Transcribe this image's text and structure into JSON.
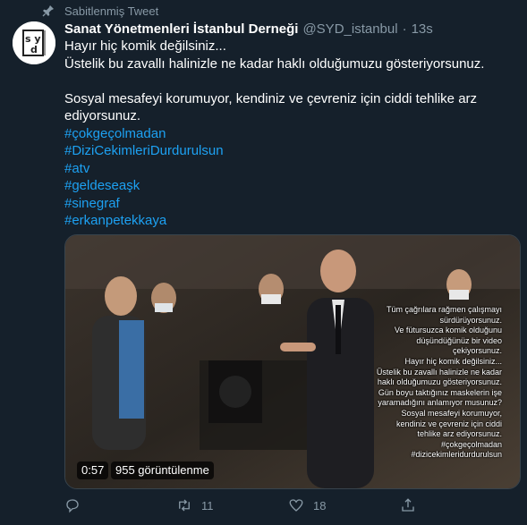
{
  "tweet": {
    "pinned_label": "Sabitlenmiş Tweet",
    "author_name": "Sanat Yönetmenleri İstanbul Derneği",
    "author_handle": "@SYD_istanbul",
    "separator": "·",
    "timestamp": "13s",
    "avatar_text": "SYD",
    "lines": [
      "Hayır hiç komik değilsiniz...",
      "Üstelik bu zavallı halinizle ne kadar haklı olduğumuzu gösteriyorsunuz.",
      "Sosyal mesafeyi korumuyor, kendiniz ve çevreniz için ciddi tehlike arz ediyorsunuz."
    ],
    "hashtags": [
      "#çokgeçolmadan",
      "#DiziCekimleriDurdurulsun",
      "#atv",
      "#geldeseaşk",
      "#sinegraf",
      "#erkanpetekkaya"
    ]
  },
  "media": {
    "duration": "0:57",
    "views": "955 görüntülenme",
    "overlay_lines": [
      "Tüm çağrılara rağmen çalışmayı",
      "sürdürüyorsunuz.",
      "Ve fütursuzca komik olduğunu",
      "düşündüğünüz bir video",
      "çekiyorsunuz.",
      "Hayır hiç komik değilsiniz...",
      "Üstelik bu zavallı halinizle ne kadar",
      "haklı olduğumuzu gösteriyorsunuz.",
      "Gün boyu taktığınız maskelerin işe",
      "yaramadığını anlamıyor musunuz?",
      "Sosyal mesafeyi korumuyor,",
      "kendiniz ve çevreniz için ciddi",
      "tehlike arz ediyorsunuz.",
      "#çokgeçolmadan",
      "#dizicekimleridurdurulsun"
    ]
  },
  "actions": {
    "reply_count": "",
    "retweet_count": "11",
    "like_count": "18",
    "share_count": ""
  },
  "colors": {
    "background": "#15202b",
    "secondary_text": "#8899a6",
    "link": "#1da1f2"
  }
}
